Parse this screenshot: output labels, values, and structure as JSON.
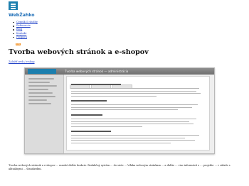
{
  "header": {
    "logo_icon": "webzahko-logo-icon",
    "site_name": "WebŽahko",
    "nav": [
      {
        "label": "Cenník & služby"
      },
      {
        "label": "Referencie"
      },
      {
        "label": "Blog"
      },
      {
        "label": "Kontakt"
      },
      {
        "label": "Podpora"
      }
    ],
    "rss_label": "RSS"
  },
  "main": {
    "title": "Tvorba webových stránok a e-shopov",
    "cta_link": "Založiť web / e-shop",
    "description": "Tvorba webových stránok a e-shopov ... mnohé ďalšie funkcie. Redakčný systém ... do siete ... Vďaka webovým stránkam ... a ďalšie ... viac informácií o ... projekte ... v súlade s aktuálnymi ... štandardmi.",
    "screenshot": {
      "window_title": "Tvorba webových stránok — administrácia",
      "content_heading": "Testovací produkt"
    }
  },
  "colors": {
    "brand": "#1c7fae",
    "link": "#2344c8",
    "site_name": "#1f6fb8",
    "rss": "#f28c1a"
  }
}
